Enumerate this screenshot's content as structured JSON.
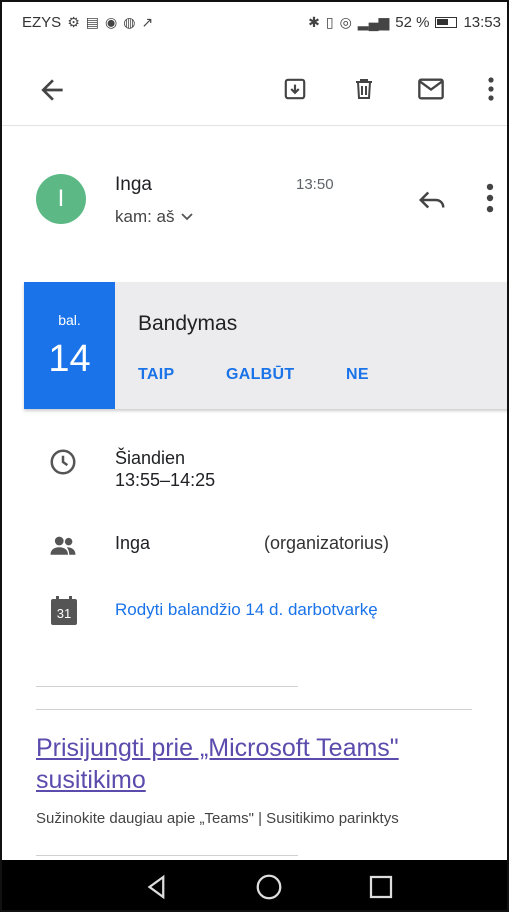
{
  "status_bar": {
    "carrier": "EZYS",
    "battery": "52 %",
    "time": "13:53",
    "battery_level": 0.52
  },
  "toolbar": {
    "back": "arrow-back-icon",
    "archive": "archive-icon",
    "delete": "trash-icon",
    "mark_unread": "mail-icon",
    "more": "more-vert-icon"
  },
  "message": {
    "avatar_letter": "I",
    "avatar_color": "#5cb985",
    "sender": "Inga",
    "time": "13:50",
    "recipient": "kam: aš"
  },
  "event": {
    "month": "bal.",
    "day": "14",
    "title": "Bandymas",
    "rsvp": {
      "yes": "TAIP",
      "maybe": "GALBŪT",
      "no": "NE"
    },
    "accent_color": "#1a73e8"
  },
  "details": {
    "when_day": "Šiandien",
    "when_time": "13:55–14:25",
    "guest_name": "Inga",
    "guest_role": "(organizatorius)",
    "calendar_day": "31",
    "agenda_link": "Rodyti balandžio 14 d. darbotvarkę"
  },
  "teams": {
    "join_link": "Prisijungti prie „Microsoft Teams\" susitikimo",
    "subtext": "Sužinokite daugiau apie „Teams\" | Susitikimo parinktys"
  }
}
